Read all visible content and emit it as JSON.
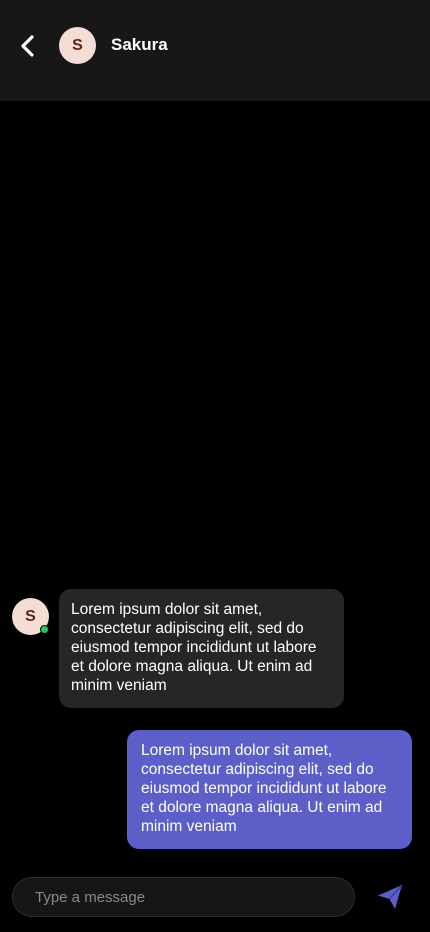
{
  "header": {
    "contact_name": "Sakura",
    "avatar_initial": "S",
    "back_icon": "chevron-left-icon"
  },
  "messages": [
    {
      "direction": "incoming",
      "avatar_initial": "S",
      "text": "Lorem ipsum dolor sit amet, consectetur adipiscing elit, sed do eiusmod tempor incididunt ut labore et dolore magna aliqua. Ut enim ad minim veniam"
    },
    {
      "direction": "outgoing",
      "text": "Lorem ipsum dolor sit amet, consectetur adipiscing elit, sed do eiusmod tempor incididunt ut labore et dolore magna aliqua. Ut enim ad minim veniam"
    }
  ],
  "composer": {
    "placeholder": "Type a message",
    "value": "",
    "send_icon": "send-icon"
  },
  "colors": {
    "background": "#000000",
    "header_bg": "#171717",
    "incoming_bubble": "#262626",
    "outgoing_bubble": "#5b5fc7",
    "accent": "#5b5fc7",
    "avatar_bg": "#f3ddd4",
    "avatar_text": "#5e2418",
    "online": "#22c55e"
  }
}
